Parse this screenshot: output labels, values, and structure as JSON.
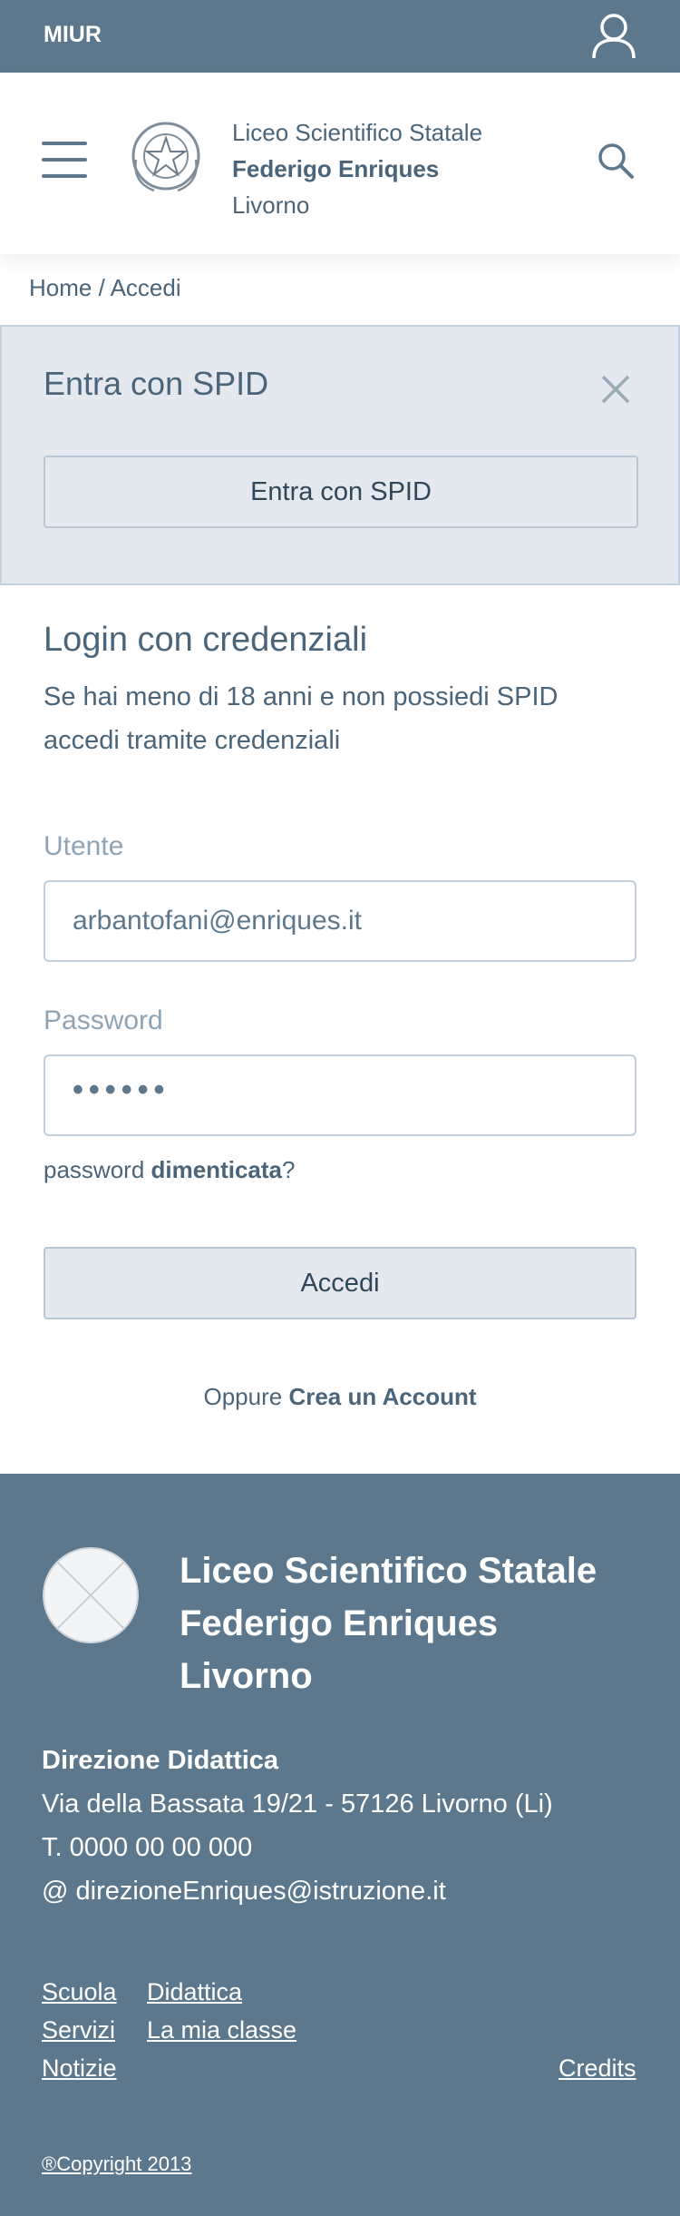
{
  "topbar": {
    "brand": "MIUR",
    "user_icon": "user-icon"
  },
  "header": {
    "menu_icon": "hamburger-icon",
    "emblem_icon": "republic-emblem-icon",
    "school_line1": "Liceo Scientifico Statale",
    "school_line2": "Federigo Enriques",
    "school_line3": "Livorno",
    "search_icon": "search-icon"
  },
  "breadcrumb": {
    "text": "Home / Accedi"
  },
  "spid": {
    "title": "Entra con SPID",
    "close_icon": "close-icon",
    "button_label": "Entra con SPID"
  },
  "login": {
    "title": "Login con credenziali",
    "subtitle": "Se hai meno di 18 anni e non possiedi SPID accedi tramite credenziali",
    "user_label": "Utente",
    "user_value": "arbantofani@enriques.it",
    "password_label": "Password",
    "password_value": "••••••",
    "forgot_prefix": "password ",
    "forgot_bold": "dimenticata",
    "forgot_suffix": "?",
    "submit_label": "Accedi",
    "create_prefix": "Oppure ",
    "create_link": "Crea un Account"
  },
  "footer": {
    "logo_icon": "placeholder-logo-icon",
    "title_line1": "Liceo Scientifico Statale",
    "title_line2": "Federigo Enriques",
    "title_line3": "Livorno",
    "direction": "Direzione Didattica",
    "address": "Via della Bassata 19/21 - 57126 Livorno (Li)",
    "phone": "T. 0000 00 00 000",
    "email": "@ direzioneEnriques@istruzione.it",
    "links": {
      "scuola": "Scuola",
      "didattica": "Didattica",
      "servizi": "Servizi",
      "classe": "La mia classe",
      "notizie": "Notizie",
      "credits": "Credits"
    },
    "copyright": "®Copyright 2013"
  },
  "colors": {
    "topbar_bg": "#5d788c",
    "spid_bg": "#e4e9ef",
    "text": "#4a6579",
    "footer_bg": "#5d788c"
  }
}
